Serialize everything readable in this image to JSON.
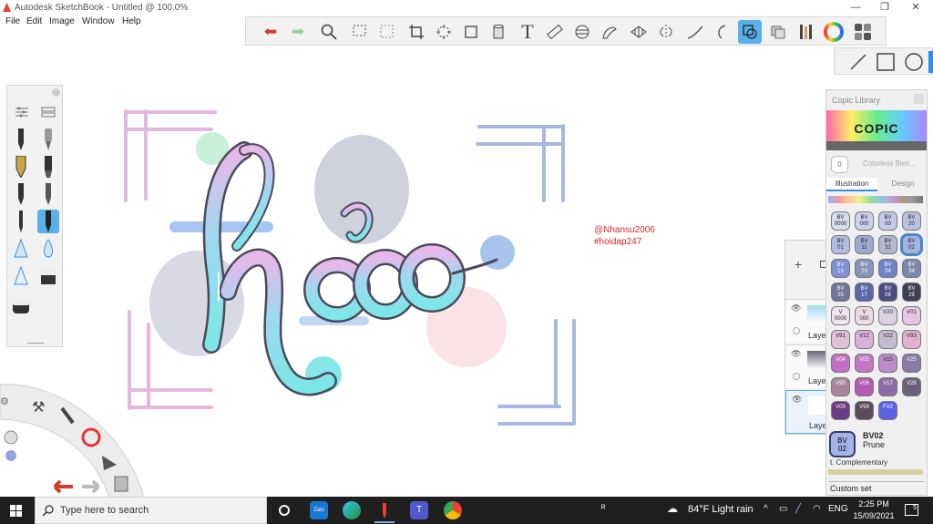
{
  "window": {
    "title": "Autodesk SketchBook - Untitled @ 100.0%",
    "min_glyph": "—",
    "max_glyph": "❐",
    "close_glyph": "✕"
  },
  "menu": [
    "File",
    "Edit",
    "Image",
    "Window",
    "Help"
  ],
  "toolbar": {
    "icons": [
      "undo-icon",
      "redo-icon",
      "zoom-icon",
      "select-icon",
      "lasso-select-icon",
      "crop-icon",
      "transform-icon",
      "distort-icon",
      "fill-icon",
      "text-icon",
      "ruler-icon",
      "ellipse-guide-icon",
      "french-curve-icon",
      "perspective-icon",
      "symmetry-icon",
      "stroke-icon",
      "shape-icon",
      "predictive-stroke-icon",
      "layer-icon",
      "copic-color-icon",
      "color-wheel-icon",
      "brush-palette-icon"
    ],
    "active": "predictive-stroke-icon"
  },
  "canvas": {
    "watermark_line1": "@Nhansu2006",
    "watermark_line2": "#hoidap247",
    "colors": {
      "pink": "#e4b8dc",
      "blue": "#a8b8e2",
      "teal": "#7de6e6",
      "grey": "#cfd1dc",
      "outline": "#4a4a5c"
    }
  },
  "layers": {
    "items": [
      {
        "label": "Laye"
      },
      {
        "label": "Laye"
      },
      {
        "label": "Laye"
      }
    ]
  },
  "copic": {
    "header": "Copic Library",
    "logo": "COPIC",
    "colorless": "Colorless Blen...",
    "colorless_badge": "0",
    "tabs": [
      "Illustration",
      "Design"
    ],
    "swatches": [
      {
        "code": "BV\n0000",
        "hex": "#d8dcef"
      },
      {
        "code": "BV\n000",
        "hex": "#cdd2ea"
      },
      {
        "code": "BV\n00",
        "hex": "#c4c9e6"
      },
      {
        "code": "BV\n20",
        "hex": "#bcc3e0"
      },
      {
        "code": "BV\n01",
        "hex": "#b3bde3"
      },
      {
        "code": "BV\n11",
        "hex": "#a2a8d4"
      },
      {
        "code": "BV\n31",
        "hex": "#b6b8d2"
      },
      {
        "code": "BV\n02",
        "hex": "#a4b4e6"
      },
      {
        "code": "BV\n13",
        "hex": "#7f8fd1"
      },
      {
        "code": "BV\n23",
        "hex": "#8a93b9"
      },
      {
        "code": "BV\n04",
        "hex": "#6e84c8"
      },
      {
        "code": "BV\n34",
        "hex": "#7f87ad"
      },
      {
        "code": "BV\n25",
        "hex": "#6f7499"
      },
      {
        "code": "BV\n17",
        "hex": "#5d66a6"
      },
      {
        "code": "BV\n08",
        "hex": "#4c4c80"
      },
      {
        "code": "BV\n29",
        "hex": "#3f3f52"
      },
      {
        "code": "V\n0000",
        "hex": "#f0e5ee"
      },
      {
        "code": "V\n000",
        "hex": "#ecdcea"
      },
      {
        "code": "V20",
        "hex": "#d9d3e3"
      },
      {
        "code": "V01",
        "hex": "#e4c7e2"
      },
      {
        "code": "V91",
        "hex": "#e2c2d8"
      },
      {
        "code": "V12",
        "hex": "#d7b2d8"
      },
      {
        "code": "V22",
        "hex": "#c3bcd0"
      },
      {
        "code": "V93",
        "hex": "#e0b2cd"
      },
      {
        "code": "V04",
        "hex": "#c070c6"
      },
      {
        "code": "V05",
        "hex": "#c277c4"
      },
      {
        "code": "V15",
        "hex": "#bb8cc7"
      },
      {
        "code": "V25",
        "hex": "#8a7ca6"
      },
      {
        "code": "V95",
        "hex": "#a8849f"
      },
      {
        "code": "V06",
        "hex": "#b35bb1"
      },
      {
        "code": "V17",
        "hex": "#8d6ca8"
      },
      {
        "code": "V28",
        "hex": "#6b5f7c"
      },
      {
        "code": "V09",
        "hex": "#6e3a84"
      },
      {
        "code": "V99",
        "hex": "#5a4c59"
      },
      {
        "code": "FV2",
        "hex": "#5b62e3"
      }
    ],
    "selected_code": "BV\n02",
    "selected_name": "BV02",
    "selected_desc": "Prune",
    "complementary": "t. Complementary",
    "custom_set": "Custom set"
  },
  "taskbar": {
    "search_placeholder": "Type here to search",
    "weather": "84°F  Light rain",
    "lang": "ENG",
    "time": "2:25 PM",
    "date": "15/09/2021",
    "notif": "5"
  }
}
